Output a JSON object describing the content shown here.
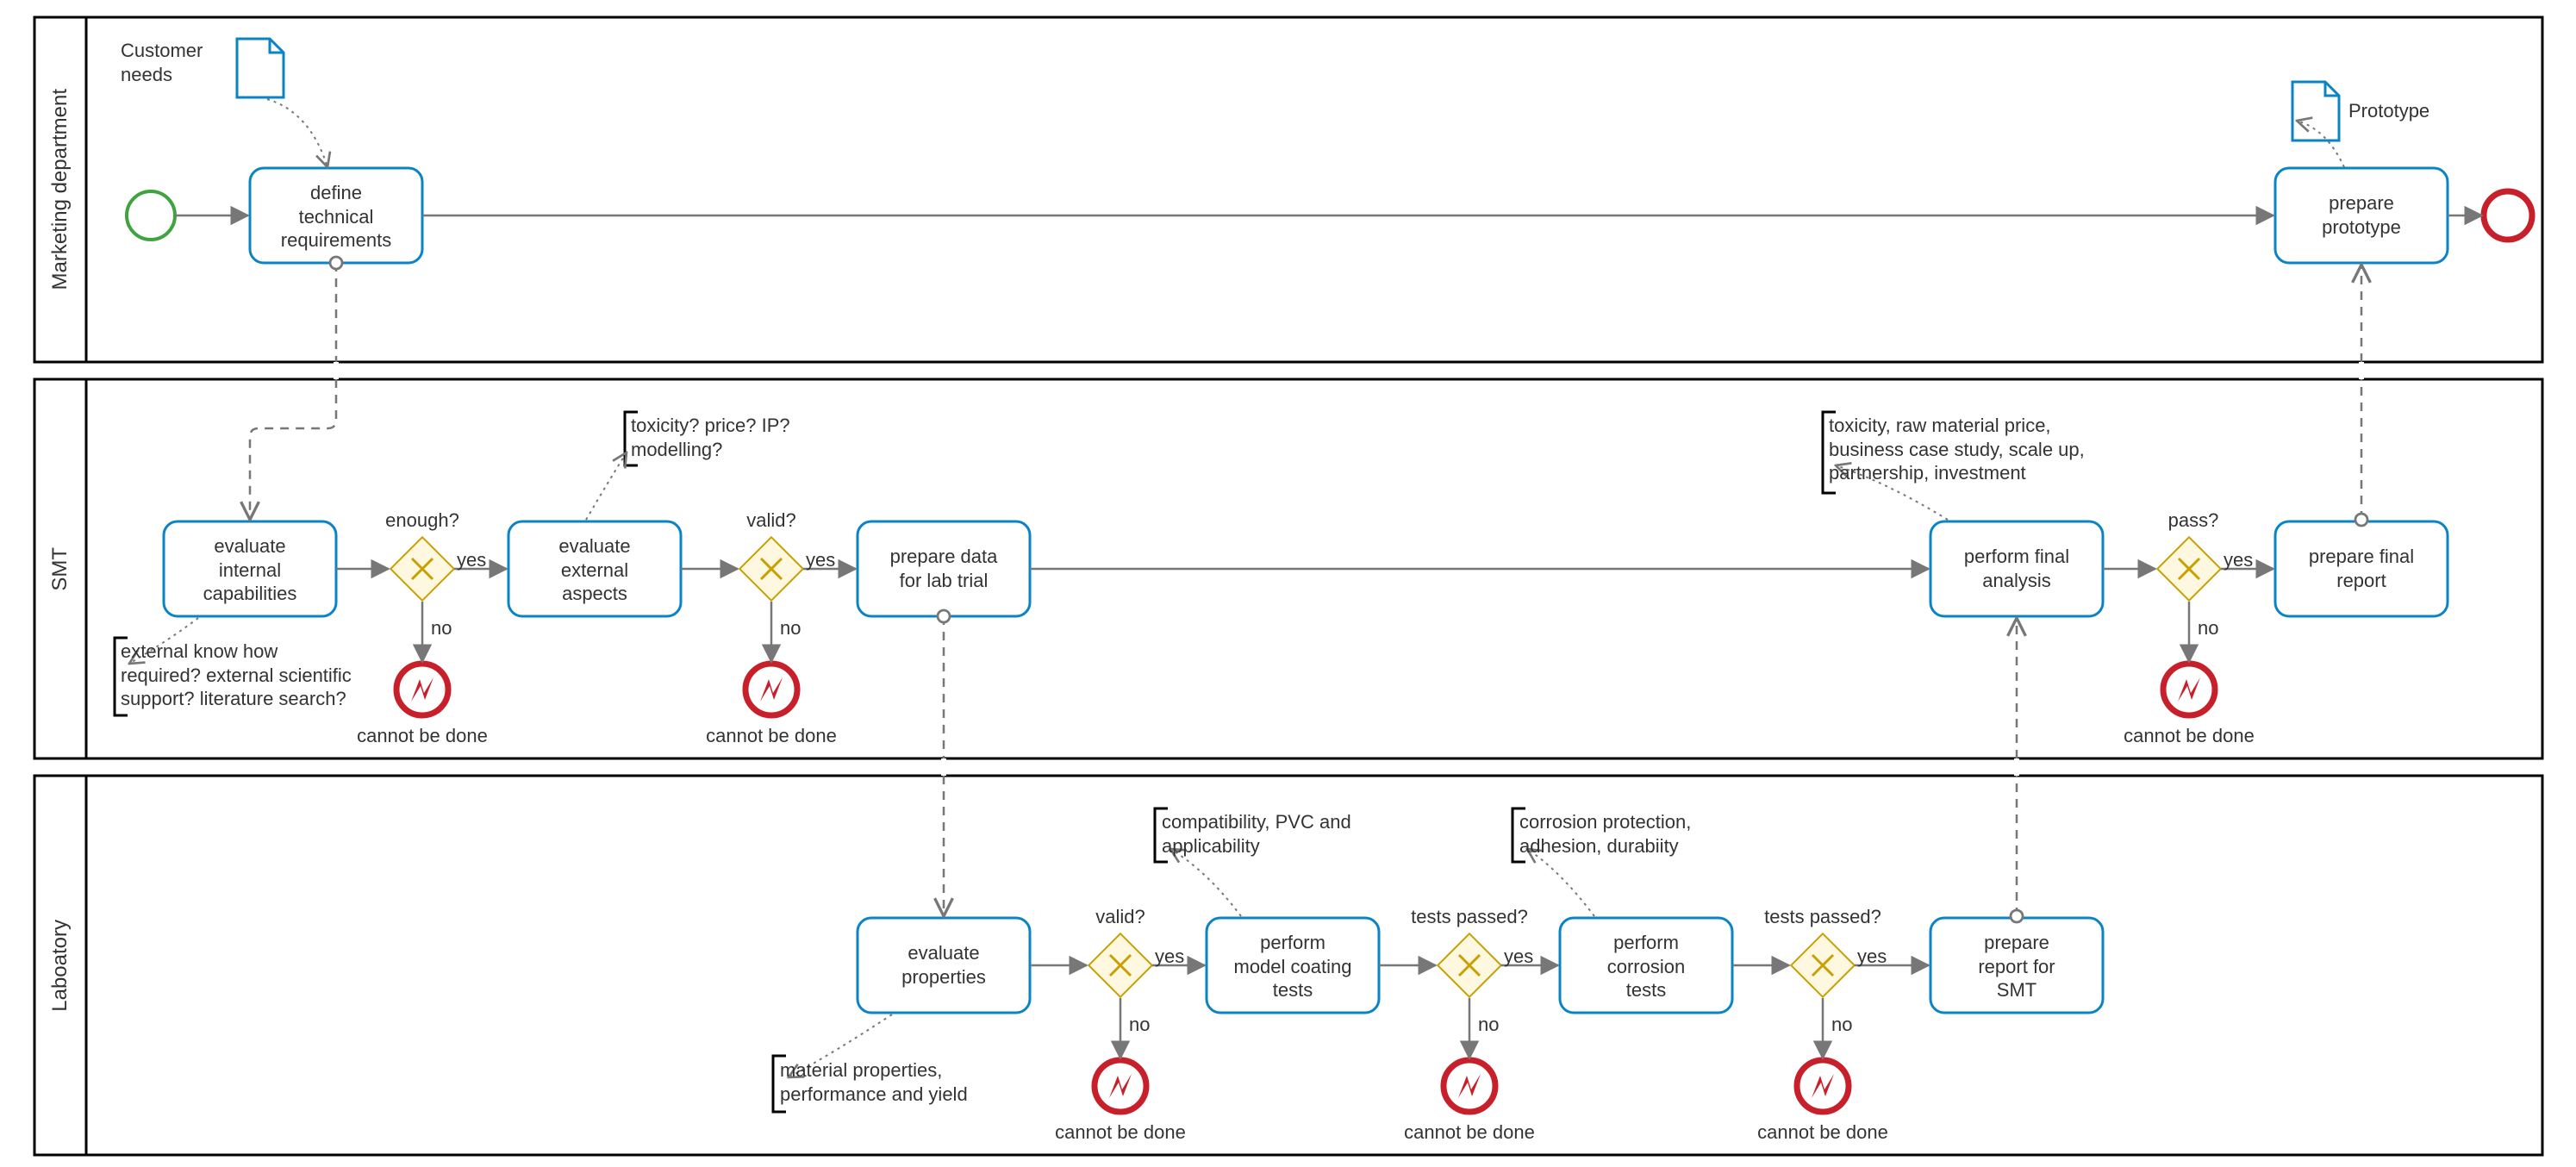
{
  "chart_data": {
    "type": "bpmn",
    "lanes": [
      {
        "id": "lane1",
        "name": "Marketing department"
      },
      {
        "id": "lane2",
        "name": "SMT"
      },
      {
        "id": "lane3",
        "name": "Laboatory"
      }
    ],
    "tasks": [
      {
        "id": "t_define",
        "lane": "lane1",
        "label": "define\ntechnical\nrequirements"
      },
      {
        "id": "t_proto",
        "lane": "lane1",
        "label": "prepare\nprototype"
      },
      {
        "id": "t_intcap",
        "lane": "lane2",
        "label": "evaluate\ninternal\ncapabilities"
      },
      {
        "id": "t_ext",
        "lane": "lane2",
        "label": "evaluate\nexternal\naspects"
      },
      {
        "id": "t_data",
        "lane": "lane2",
        "label": "prepare data\nfor lab trial"
      },
      {
        "id": "t_final",
        "lane": "lane2",
        "label": "perform final\nanalysis"
      },
      {
        "id": "t_frep",
        "lane": "lane2",
        "label": "prepare final\nreport"
      },
      {
        "id": "t_prop",
        "lane": "lane3",
        "label": "evaluate\nproperties"
      },
      {
        "id": "t_coat",
        "lane": "lane3",
        "label": "perform\nmodel coating\ntests"
      },
      {
        "id": "t_corr",
        "lane": "lane3",
        "label": "perform\ncorrosion\ntests"
      },
      {
        "id": "t_labrep",
        "lane": "lane3",
        "label": "prepare\nreport for\nSMT"
      }
    ],
    "gateways": [
      {
        "id": "g1",
        "lane": "lane2",
        "label": "enough?"
      },
      {
        "id": "g2",
        "lane": "lane2",
        "label": "valid?"
      },
      {
        "id": "g3",
        "lane": "lane2",
        "label": "pass?"
      },
      {
        "id": "g4",
        "lane": "lane3",
        "label": "valid?"
      },
      {
        "id": "g5",
        "lane": "lane3",
        "label": "tests passed?"
      },
      {
        "id": "g6",
        "lane": "lane3",
        "label": "tests passed?"
      }
    ],
    "events": [
      {
        "id": "e_start",
        "type": "start",
        "lane": "lane1"
      },
      {
        "id": "e_end",
        "type": "end",
        "lane": "lane1"
      },
      {
        "id": "e_err1",
        "type": "error",
        "lane": "lane2",
        "label": "cannot be done"
      },
      {
        "id": "e_err2",
        "type": "error",
        "lane": "lane2",
        "label": "cannot be done"
      },
      {
        "id": "e_err3",
        "type": "error",
        "lane": "lane2",
        "label": "cannot be done"
      },
      {
        "id": "e_err4",
        "type": "error",
        "lane": "lane3",
        "label": "cannot be done"
      },
      {
        "id": "e_err5",
        "type": "error",
        "lane": "lane3",
        "label": "cannot be done"
      },
      {
        "id": "e_err6",
        "type": "error",
        "lane": "lane3",
        "label": "cannot be done"
      }
    ],
    "data_objects": [
      {
        "id": "d_cust",
        "label": "Customer\nneeds"
      },
      {
        "id": "d_proto",
        "label": "Prototype"
      }
    ],
    "annotations": [
      {
        "id": "a_int",
        "text": "external know how\nrequired? external scientific\nsupport? literature search?"
      },
      {
        "id": "a_ext",
        "text": "toxicity? price? IP?\nmodelling?"
      },
      {
        "id": "a_final",
        "text": "toxicity, raw material price,\nbusiness case study, scale up,\npartnership, investment"
      },
      {
        "id": "a_prop",
        "text": "material properties,\nperformance and yield"
      },
      {
        "id": "a_coat",
        "text": "compatibility, PVC and\napplicability"
      },
      {
        "id": "a_corr",
        "text": "corrosion protection,\nadhesion, durabiity"
      }
    ],
    "edge_labels": {
      "yes": "yes",
      "no": "no"
    }
  },
  "labels": {
    "lane1": "Marketing department",
    "lane2": "SMT",
    "lane3": "Laboatory",
    "t_define": "define\ntechnical\nrequirements",
    "t_proto": "prepare\nprototype",
    "t_intcap": "evaluate\ninternal\ncapabilities",
    "t_ext": "evaluate\nexternal\naspects",
    "t_data": "prepare data\nfor lab trial",
    "t_final": "perform final\nanalysis",
    "t_frep": "prepare final\nreport",
    "t_prop": "evaluate\nproperties",
    "t_coat": "perform\nmodel coating\ntests",
    "t_corr": "perform\ncorrosion\ntests",
    "t_labrep": "prepare\nreport for\nSMT",
    "g1": "enough?",
    "g2": "valid?",
    "g3": "pass?",
    "g4": "valid?",
    "g5": "tests passed?",
    "g6": "tests passed?",
    "err": "cannot be done",
    "yes": "yes",
    "no": "no",
    "d_cust": "Customer\nneeds",
    "d_proto": "Prototype",
    "a_int": "external know how\nrequired? external scientific\nsupport? literature search?",
    "a_ext": "toxicity? price? IP?\nmodelling?",
    "a_final": "toxicity, raw material price,\nbusiness case study, scale up,\npartnership, investment",
    "a_prop": "material properties,\nperformance and yield",
    "a_coat": "compatibility, PVC and\napplicability",
    "a_corr": "corrosion protection,\nadhesion, durabiity"
  }
}
